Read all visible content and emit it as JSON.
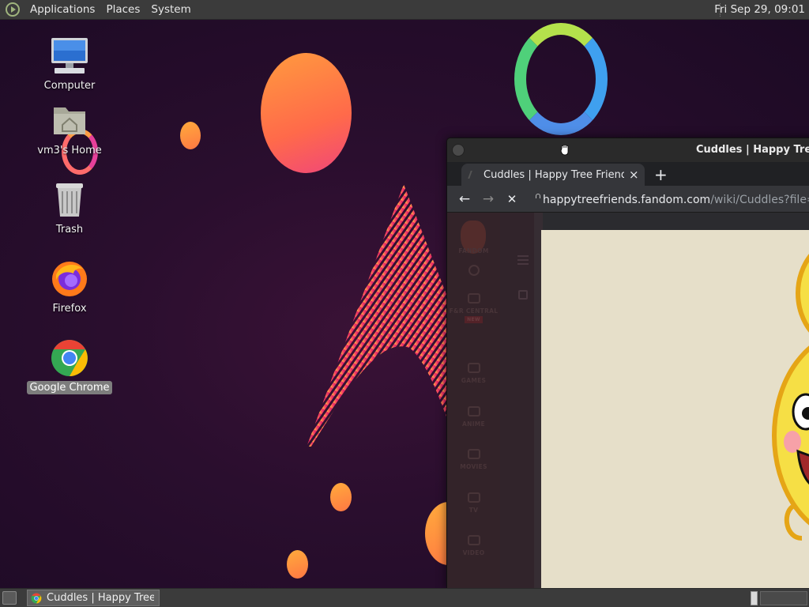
{
  "top_panel": {
    "menus": [
      "Applications",
      "Places",
      "System"
    ],
    "clock": "Fri Sep 29, 09:01"
  },
  "desktop_icons": [
    {
      "label": "Computer",
      "icon": "computer-icon"
    },
    {
      "label": "vm3's Home",
      "icon": "home-folder-icon"
    },
    {
      "label": "Trash",
      "icon": "trash-icon"
    },
    {
      "label": "Firefox",
      "icon": "firefox-icon"
    },
    {
      "label": "Google Chrome",
      "icon": "chrome-icon",
      "selected": true
    }
  ],
  "browser": {
    "window_title": "Cuddles | Happy Tree Fr",
    "tab_title": "Cuddles | Happy Tree Friends W",
    "tab_close": "×",
    "new_tab": "+",
    "nav": {
      "back": "←",
      "forward": "→",
      "stop": "✕"
    },
    "url_host": "happytreefriends.fandom.com",
    "url_path": "/wiki/Cuddles?file=Cu",
    "fandom_rail": [
      {
        "label": "FANDOM"
      },
      {
        "label": "F&R CENTRAL",
        "badge": "NEW"
      },
      {
        "label": "GAMES"
      },
      {
        "label": "ANIME"
      },
      {
        "label": "MOVIES"
      },
      {
        "label": "TV"
      },
      {
        "label": "VIDEO"
      }
    ]
  },
  "taskbar": {
    "task_label": "Cuddles | Happy Tree..."
  },
  "colors": {
    "panel_bg": "#3b3b3b",
    "wallpaper_bg": "#230d2c",
    "browser_bg": "#35363a",
    "selected_label_bg": "#7d7d7d"
  }
}
